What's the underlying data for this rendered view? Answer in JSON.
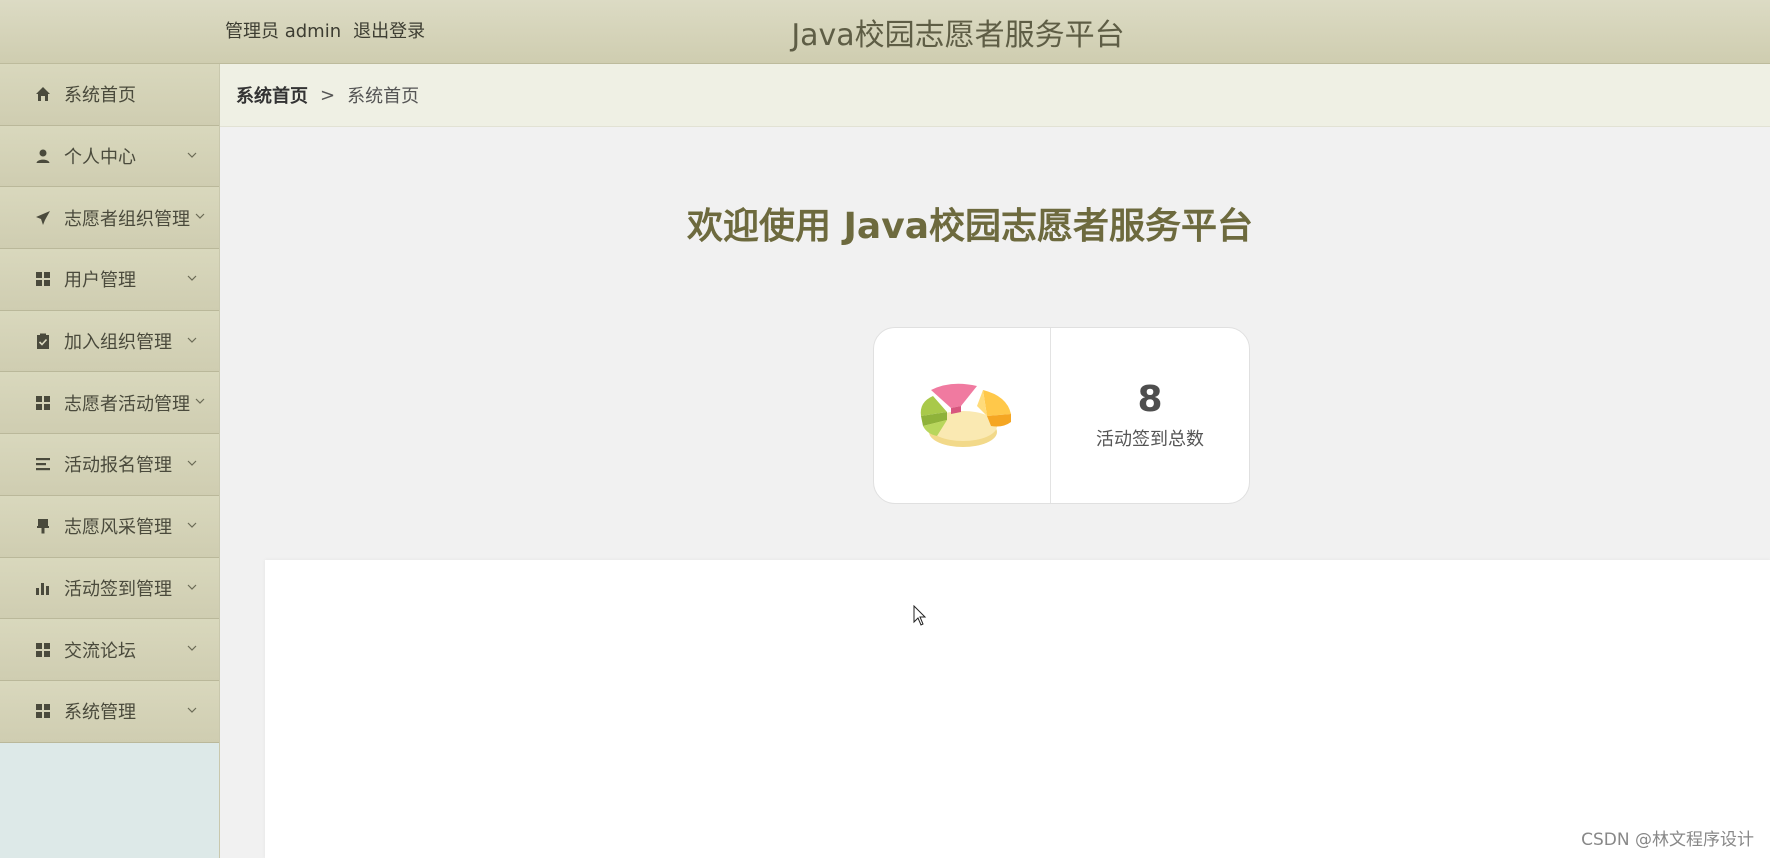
{
  "header": {
    "user_label": "管理员 admin",
    "logout_label": "退出登录",
    "app_title": "Java校园志愿者服务平台"
  },
  "sidebar": {
    "items": [
      {
        "label": "系统首页",
        "icon": "home-icon"
      },
      {
        "label": "个人中心",
        "icon": "user-icon"
      },
      {
        "label": "志愿者组织管理",
        "icon": "paper-plane-icon"
      },
      {
        "label": "用户管理",
        "icon": "grid-icon"
      },
      {
        "label": "加入组织管理",
        "icon": "clipboard-check-icon"
      },
      {
        "label": "志愿者活动管理",
        "icon": "grid-icon"
      },
      {
        "label": "活动报名管理",
        "icon": "list-icon"
      },
      {
        "label": "志愿风采管理",
        "icon": "brush-icon"
      },
      {
        "label": "活动签到管理",
        "icon": "bar-chart-icon"
      },
      {
        "label": "交流论坛",
        "icon": "grid-icon"
      },
      {
        "label": "系统管理",
        "icon": "grid-icon"
      }
    ]
  },
  "breadcrumb": {
    "root": "系统首页",
    "separator": ">",
    "current": "系统首页"
  },
  "main": {
    "welcome": "欢迎使用 Java校园志愿者服务平台",
    "stat": {
      "value": "8",
      "label": "活动签到总数"
    }
  },
  "watermark": "CSDN @林文程序设计",
  "colors": {
    "header_bg": "#d5d3b8",
    "sidebar_bg": "#d4d2b6",
    "welcome_text": "#6d6a3e"
  }
}
